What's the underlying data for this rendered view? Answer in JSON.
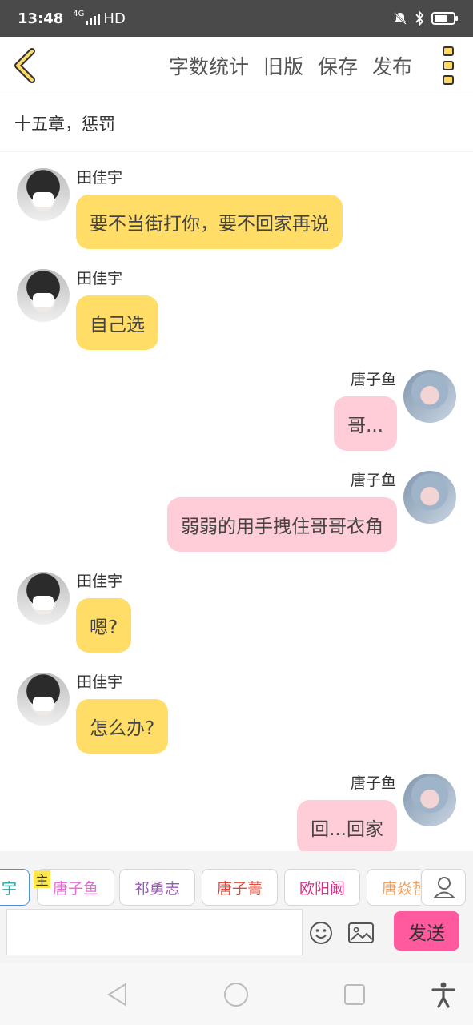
{
  "status_bar": {
    "time": "13:48",
    "network": "4G",
    "hd": "HD"
  },
  "toolbar": {
    "word_count": "字数统计",
    "old_version": "旧版",
    "save": "保存",
    "publish": "发布"
  },
  "chapter_title": "十五章，惩罚",
  "messages": [
    {
      "sender": "田佳宇",
      "text": "要不当街打你，要不回家再说"
    },
    {
      "sender": "田佳宇",
      "text": "自己选"
    },
    {
      "sender": "唐子鱼",
      "text": "哥..."
    },
    {
      "sender": "唐子鱼",
      "text": "弱弱的用手拽住哥哥衣角"
    },
    {
      "sender": "田佳宇",
      "text": "嗯?"
    },
    {
      "sender": "田佳宇",
      "text": "怎么办?"
    },
    {
      "sender": "唐子鱼",
      "text": "回...回家"
    }
  ],
  "characters": [
    {
      "name": "宇",
      "color": "#2ba6a0"
    },
    {
      "name": "唐子鱼",
      "color": "#e86ad6"
    },
    {
      "name": "祁勇志",
      "color": "#9b59b6"
    },
    {
      "name": "唐子菁",
      "color": "#e04a3a"
    },
    {
      "name": "欧阳阚",
      "color": "#d63384"
    },
    {
      "name": "唐焱哲",
      "color": "#f0a060"
    }
  ],
  "main_badge": "主",
  "input": {
    "placeholder": ""
  },
  "send_label": "发送",
  "colors": {
    "accent": "#ff5a9d",
    "bubble_left": "#ffdd66",
    "bubble_right": "#ffcdd8"
  }
}
